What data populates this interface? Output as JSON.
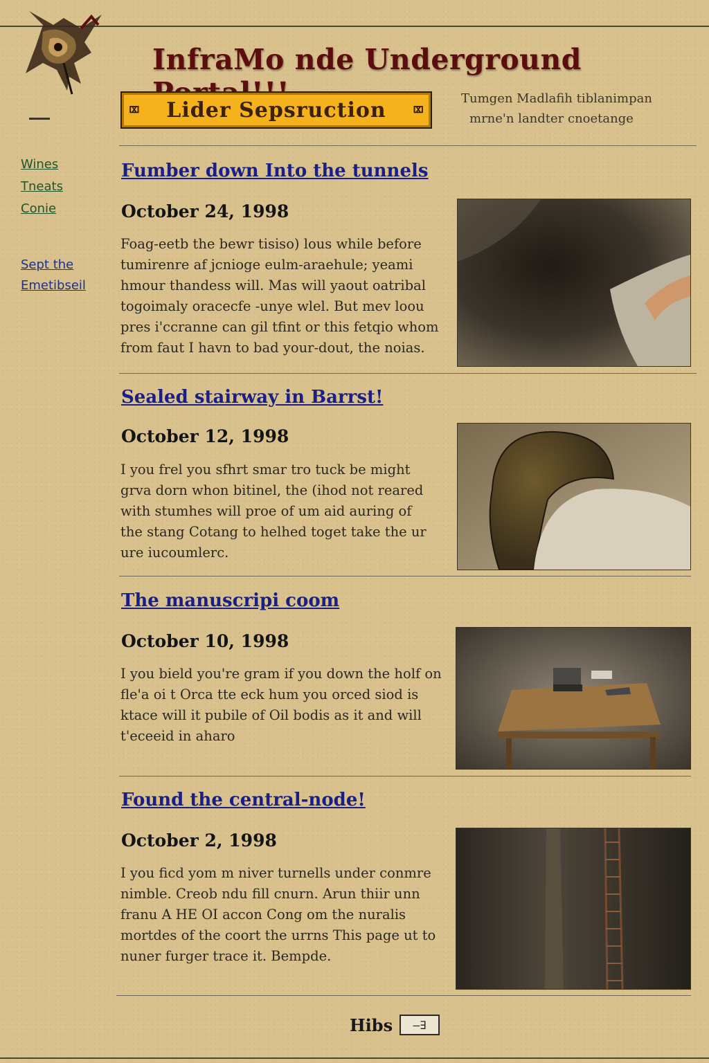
{
  "header": {
    "title": "InfraMo nde Underground Portal!!!",
    "banner_text": "Lider Sepsruction",
    "banner_left_glyph": "⌧",
    "banner_right_glyph": "⌧",
    "tagline_line1": "Tumgen Madlafih tiblanimpan",
    "tagline_line2": "mrne'n landter cnoetange"
  },
  "nav": {
    "items": [
      {
        "label": "Wines"
      },
      {
        "label": "Tneats"
      },
      {
        "label": "Conie"
      }
    ],
    "secondary": [
      {
        "label": "Sept the"
      },
      {
        "label": "Emetibseil"
      }
    ]
  },
  "posts": [
    {
      "title": "Fumber down Into the tunnels",
      "date": "October 24, 1998",
      "body": "Foag-eetb the bewr tisiso) lous while before tumirenre af jcnioge eulm-araehule; yeami hmour thandess will. Mas will yaout oatribal togoimaly oracecfe -unye wlel. But mev loou pres i'ccranne can gil tfint or this fetqio whom from faut I havn to bad your-dout, the noias.",
      "image_icon": "tunnel-photo"
    },
    {
      "title": "Sealed stairway in Barrst!",
      "date": "October 12, 1998",
      "body": "I you frel you sfhrt smar tro tuck be might grva dorn whon bitinel, the (ihod not reared with stumhes will proe of um aid auring of the stang Cotang to helhed toget take the ur ure iucoumlerc.",
      "image_icon": "stairway-photo"
    },
    {
      "title": "The manuscripi coom",
      "date": "October 10, 1998",
      "body": "I you bield you're gram if you down the holf on fle'a oi t Orca tte eck hum you orced siod is ktace will it pubile of Oil bodis as it and will t'eceeid in aharo",
      "image_icon": "manuscript-room-photo"
    },
    {
      "title": "Found the central-node!",
      "date": "October 2, 1998",
      "body": "I you ficd yom m niver turnells under conmre nimble. Creob ndu fill cnurn. Arun thiir unn franu A HE OI accon Cong om the nuralis mortdes of the coort the urrns This page ut to nuner furger trace it. Bempde.",
      "image_icon": "ladder-shaft-photo"
    }
  ],
  "footer": {
    "label": "Hibs",
    "button": "—∃"
  }
}
